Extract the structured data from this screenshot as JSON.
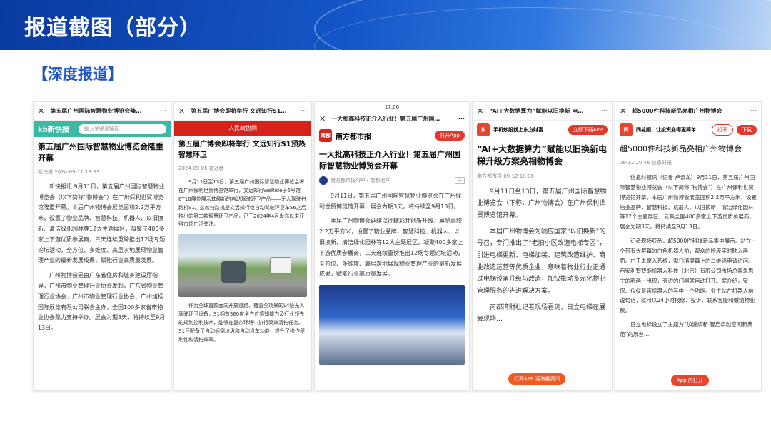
{
  "header": {
    "title": "报道截图（部分）"
  },
  "section": {
    "title": "【深度报道】"
  },
  "c1": {
    "bar_title": "第五届广州国际智慧物业博览会隆…",
    "brand": "kb新快报",
    "search_placeholder": "输入关键词搜索",
    "headline": "第五届广州国际智慧物业博览会隆重开幕",
    "meta": "新快报  2024-09-11 18:53",
    "p1": "新快报讯 9月11日，第五届广州国际智慧物业博览会（以下简称“物博会”）在广州保利世贸博览馆隆重开幕。本届广州物博会展览面积2.2万平方米，设置了物业品牌、智慧科技、机器人、以旧换新、清洁绿化园林等12大主题展区，凝聚了400多家上下游优质参展商，三天连续重磅推出12场专题论坛活动，全方位、多维度、高层次地展现物业管理产业的最新发展成果，赋能行业高质量发展。",
    "p2": "广州物博会是由广东省住房和城乡建设厅指导，广州市物业管理行业协会发起，广东省物业管理行业协会、广州市物业管理行业协会、广州旭杨国际展览有限公司联合主办，全国100多家省市物业协会鼎力支持举办。展会为期3天，将持续至9月13日。"
  },
  "c2": {
    "bar_title": "第五届广博会即将举行 文远知行S1…",
    "banner": "人民政协网",
    "headline": "第五届广博会即将举行 文远知行S1预热智慧环卫",
    "meta": "2024-09-05  被迁移",
    "p1": "9月11日至13日，第五届广州国际智慧物业博览会将在广州保利世贸博览馆举行，文远知行WeRide于6号馆6T16展位展示其最新的自动驾驶环卫产品——无人驾驶扫路机S1。这款扫路机是文远知行继自动驾驶环卫车S6之后推出的第二款智慧环卫产品，已于2024年4月发布以来获得市场广泛关注。",
    "p2": "作为全球首款面向开放道路、覆盖全场景的L4级无人驾驶环卫设备，S1拥有360度全方位感知能力及行业领先的规划控制技术，能够在复杂环境中执行高效清扫任务。S1还配备了自动倾倒垃圾和自动沿车功能，提升了操作便利性和清扫效率。"
  },
  "c3": {
    "status": "17:06",
    "bar_title": "一大批高科技正介入行业！第五届广州国…",
    "brand": "南方都市报",
    "open_app": "打开App",
    "headline": "一大批高科技正介入行业！第五届广州国际智慧物业博览会开幕",
    "source": "南方都市报APP・南都地产",
    "p1": "9月11日，第五届广州国际智慧物业博览会在广州保利世贸博览馆开幕，展会为期3天，将持续至9月13日。",
    "p2": "本届广州物博会延续以往精彩并创新升级，展览面积2.2万平方米，设置了物业品牌、智慧科技、机器人、以旧换新、清洁绿化园林等12大主题展区，凝聚400多家上下游优质参展商，三天连续重磅推出12场专题论坛活动，全方位、多维度、高层次地展现物业管理产业的最新发展成果，赋能行业高质量发展。"
  },
  "c4": {
    "bar_title": "“AI+大数据算力”赋能以旧换新 电…",
    "brand": "手机炒股就上东方财富",
    "download": "立即下载APP",
    "headline": "“AI+大数据算力”赋能以旧换新电梯升级方案亮相物博会",
    "meta": "南方都市报    09-12 18:06",
    "p1": "9月11日至13日，第五届广州国际智慧物业博览会（下称：广州物博会）在广州保利世贸博览馆开幕。",
    "p2": "本届广州物博会为响应国家“以旧换新”的号召，专门推出了“老旧小区改造电梯专区”，引进电梯更新、电梯加装、建筑改造维护、商业改造运营等优质企业，意味着物业行业正通过电梯设备升级与改造，加快推动多元化物业管理服务的先进解决方案。",
    "p3": "南都湾财社记者现场看见，日立电梯在展会现场…",
    "float": "打开APP 读海量资讯"
  },
  "c5": {
    "bar_title": "超5000件科技新品亮相广州物博会",
    "brand": "同花顺，让投资变得更简单",
    "open": "打开",
    "download": "下载",
    "headline": "超5000件科技新品亮相广州物博会",
    "meta": "09-12 20:46  信息时报",
    "p1": "信息时报讯（记者 卢云龙）9月11日，第五届广州国际智慧物业博览会（以下简称“物博会”）在广州保利世贸博览馆开幕。本届广州物博会展览面积2.2万平方米，设置物业品牌、智慧科技、机器人、以旧换新、清洁绿化园林等12个主题展区，云集全国400多家上下游优质参展商，展会为期3天，将持续至9月13日。",
    "p2": "记者现场获悉，超5000件科技新品集中展示。站在一个带有大屏幕的白色机器人前，观众的脸庞实时映入画面。由于未录入系统，需扫描屏幕上的二维码申请访问。西安利智智能机器人科技（北京）有限公司市场总监朱思宁的脸画一出现，旁边的门闸就自动打开。据介绍，安保、仪仪是该机器人的其中一个功能。业主站在机器人前说句话，就可以24小时报修、投诉、联系客服和缴纳物业费。",
    "p3": "日立电梯设立了主题为“加速焕新 智启卓越空间新典范”的展台…",
    "float": "App 内打开"
  }
}
